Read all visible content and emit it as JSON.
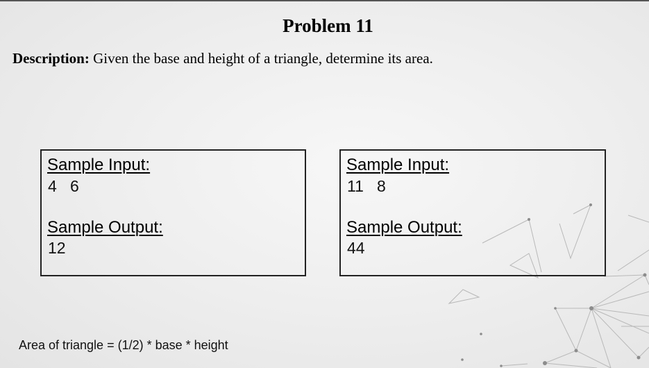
{
  "problem": {
    "title": "Problem 11",
    "description_label": "Description:",
    "description_text": " Given the base and height of a triangle, determine its area."
  },
  "samples": [
    {
      "input_label": "Sample Input:",
      "input_value": "4   6",
      "output_label": "Sample Output:",
      "output_value": "12"
    },
    {
      "input_label": "Sample Input:",
      "input_value": "11   8",
      "output_label": "Sample Output:",
      "output_value": "44"
    }
  ],
  "formula": "Area of triangle = (1/2) * base * height"
}
